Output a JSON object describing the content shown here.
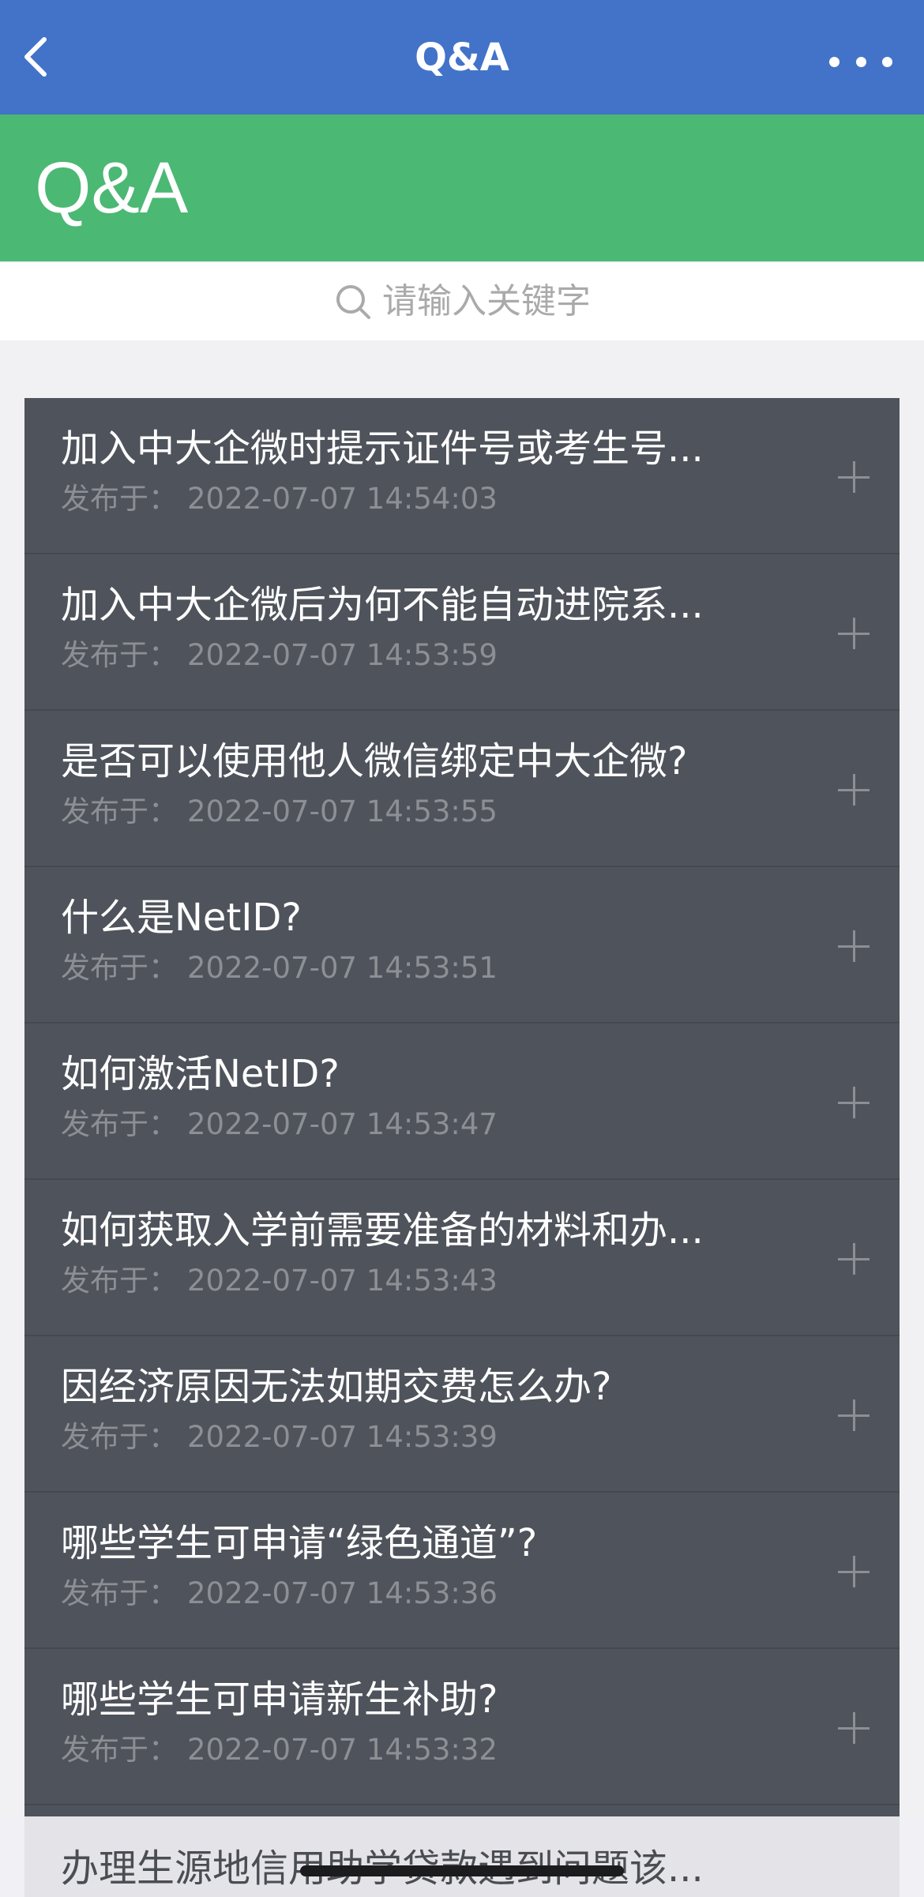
{
  "navbar": {
    "title": "Q&A",
    "back_icon": "chevron-left-icon",
    "more_icon": "more-horizontal-icon"
  },
  "banner": {
    "title": "Q&A"
  },
  "search": {
    "placeholder": "请输入关键字",
    "icon": "search-icon"
  },
  "colors": {
    "navbar_bg": "#4273c8",
    "banner_bg": "#4bb874",
    "list_bg": "#4f535b"
  },
  "list": {
    "date_label": "发布于：",
    "items": [
      {
        "title": "加入中大企微时提示证件号或考生号...",
        "date": "2022-07-07 14:54:03"
      },
      {
        "title": "加入中大企微后为何不能自动进院系...",
        "date": "2022-07-07 14:53:59"
      },
      {
        "title": "是否可以使用他人微信绑定中大企微?",
        "date": "2022-07-07 14:53:55"
      },
      {
        "title": "什么是NetID?",
        "date": "2022-07-07 14:53:51"
      },
      {
        "title": "如何激活NetID?",
        "date": "2022-07-07 14:53:47"
      },
      {
        "title": "如何获取入学前需要准备的材料和办...",
        "date": "2022-07-07 14:53:43"
      },
      {
        "title": "因经济原因无法如期交费怎么办?",
        "date": "2022-07-07 14:53:39"
      },
      {
        "title": "哪些学生可申请“绿色通道”?",
        "date": "2022-07-07 14:53:36"
      },
      {
        "title": "哪些学生可申请新生补助?",
        "date": "2022-07-07 14:53:32"
      }
    ],
    "peek_item_title": "办理生源地信用助学贷款遇到问题该..."
  }
}
